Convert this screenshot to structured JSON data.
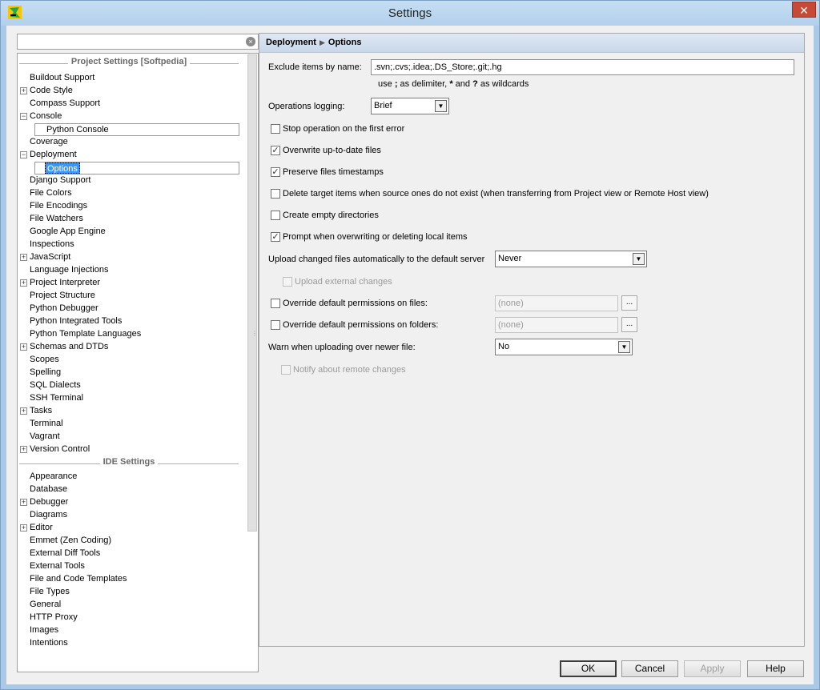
{
  "window": {
    "title": "Settings",
    "close_glyph": "✕",
    "icon": "pycharm-icon"
  },
  "search": {
    "value": "",
    "clear_glyph": "×"
  },
  "tree": {
    "project_section": "Project Settings [Softpedia]",
    "ide_section": "IDE Settings",
    "project_items": [
      {
        "label": "Buildout Support"
      },
      {
        "label": "Code Style",
        "expand": "+"
      },
      {
        "label": "Compass Support"
      },
      {
        "label": "Console",
        "expand": "−"
      },
      {
        "label": "Python Console",
        "child": true
      },
      {
        "label": "Coverage"
      },
      {
        "label": "Deployment",
        "expand": "−"
      },
      {
        "label": "Options",
        "child": true,
        "selected": true
      },
      {
        "label": "Django Support"
      },
      {
        "label": "File Colors"
      },
      {
        "label": "File Encodings"
      },
      {
        "label": "File Watchers"
      },
      {
        "label": "Google App Engine"
      },
      {
        "label": "Inspections"
      },
      {
        "label": "JavaScript",
        "expand": "+"
      },
      {
        "label": "Language Injections"
      },
      {
        "label": "Project Interpreter",
        "expand": "+"
      },
      {
        "label": "Project Structure"
      },
      {
        "label": "Python Debugger"
      },
      {
        "label": "Python Integrated Tools"
      },
      {
        "label": "Python Template Languages"
      },
      {
        "label": "Schemas and DTDs",
        "expand": "+"
      },
      {
        "label": "Scopes"
      },
      {
        "label": "Spelling"
      },
      {
        "label": "SQL Dialects"
      },
      {
        "label": "SSH Terminal"
      },
      {
        "label": "Tasks",
        "expand": "+"
      },
      {
        "label": "Terminal"
      },
      {
        "label": "Vagrant"
      },
      {
        "label": "Version Control",
        "expand": "+"
      }
    ],
    "ide_items": [
      {
        "label": "Appearance"
      },
      {
        "label": "Database"
      },
      {
        "label": "Debugger",
        "expand": "+"
      },
      {
        "label": "Diagrams"
      },
      {
        "label": "Editor",
        "expand": "+"
      },
      {
        "label": "Emmet (Zen Coding)"
      },
      {
        "label": "External Diff Tools"
      },
      {
        "label": "External Tools"
      },
      {
        "label": "File and Code Templates"
      },
      {
        "label": "File Types"
      },
      {
        "label": "General"
      },
      {
        "label": "HTTP Proxy"
      },
      {
        "label": "Images"
      },
      {
        "label": "Intentions"
      }
    ]
  },
  "breadcrumb": {
    "parent": "Deployment",
    "separator": "▶",
    "current": "Options"
  },
  "options": {
    "exclude_label": "Exclude items by name:",
    "exclude_value": ".svn;.cvs;.idea;.DS_Store;.git;.hg",
    "exclude_hint_1": "use",
    "exclude_hint_semicolon": ";",
    "exclude_hint_2": "as delimiter,",
    "exclude_hint_star": "*",
    "exclude_hint_3": "and",
    "exclude_hint_q": "?",
    "exclude_hint_4": "as wildcards",
    "logging_label": "Operations logging:",
    "logging_value": "Brief",
    "stop_on_error": {
      "label": "Stop operation on the first error",
      "checked": false
    },
    "overwrite": {
      "label": "Overwrite up-to-date files",
      "checked": true
    },
    "preserve": {
      "label": "Preserve files timestamps",
      "checked": true
    },
    "delete_target": {
      "label": "Delete target items when source ones do not exist (when transferring from Project view or Remote Host view)",
      "checked": false
    },
    "create_empty": {
      "label": "Create empty directories",
      "checked": false
    },
    "prompt_overwrite": {
      "label": "Prompt when overwriting or deleting local items",
      "checked": true
    },
    "upload_label": "Upload changed files automatically to the default server",
    "upload_value": "Never",
    "upload_external": {
      "label": "Upload external changes",
      "checked": false
    },
    "override_files": {
      "label": "Override default permissions on files:",
      "checked": false,
      "value": "(none)"
    },
    "override_folders": {
      "label": "Override default permissions on folders:",
      "checked": false,
      "value": "(none)"
    },
    "browse_glyph": "...",
    "warn_label": "Warn when uploading over newer file:",
    "warn_value": "No",
    "notify_remote": {
      "label": "Notify about remote changes",
      "checked": false
    },
    "check_glyph": "✓",
    "arrow_glyph": "▼"
  },
  "buttons": {
    "ok": "OK",
    "cancel": "Cancel",
    "apply": "Apply",
    "help": "Help"
  }
}
